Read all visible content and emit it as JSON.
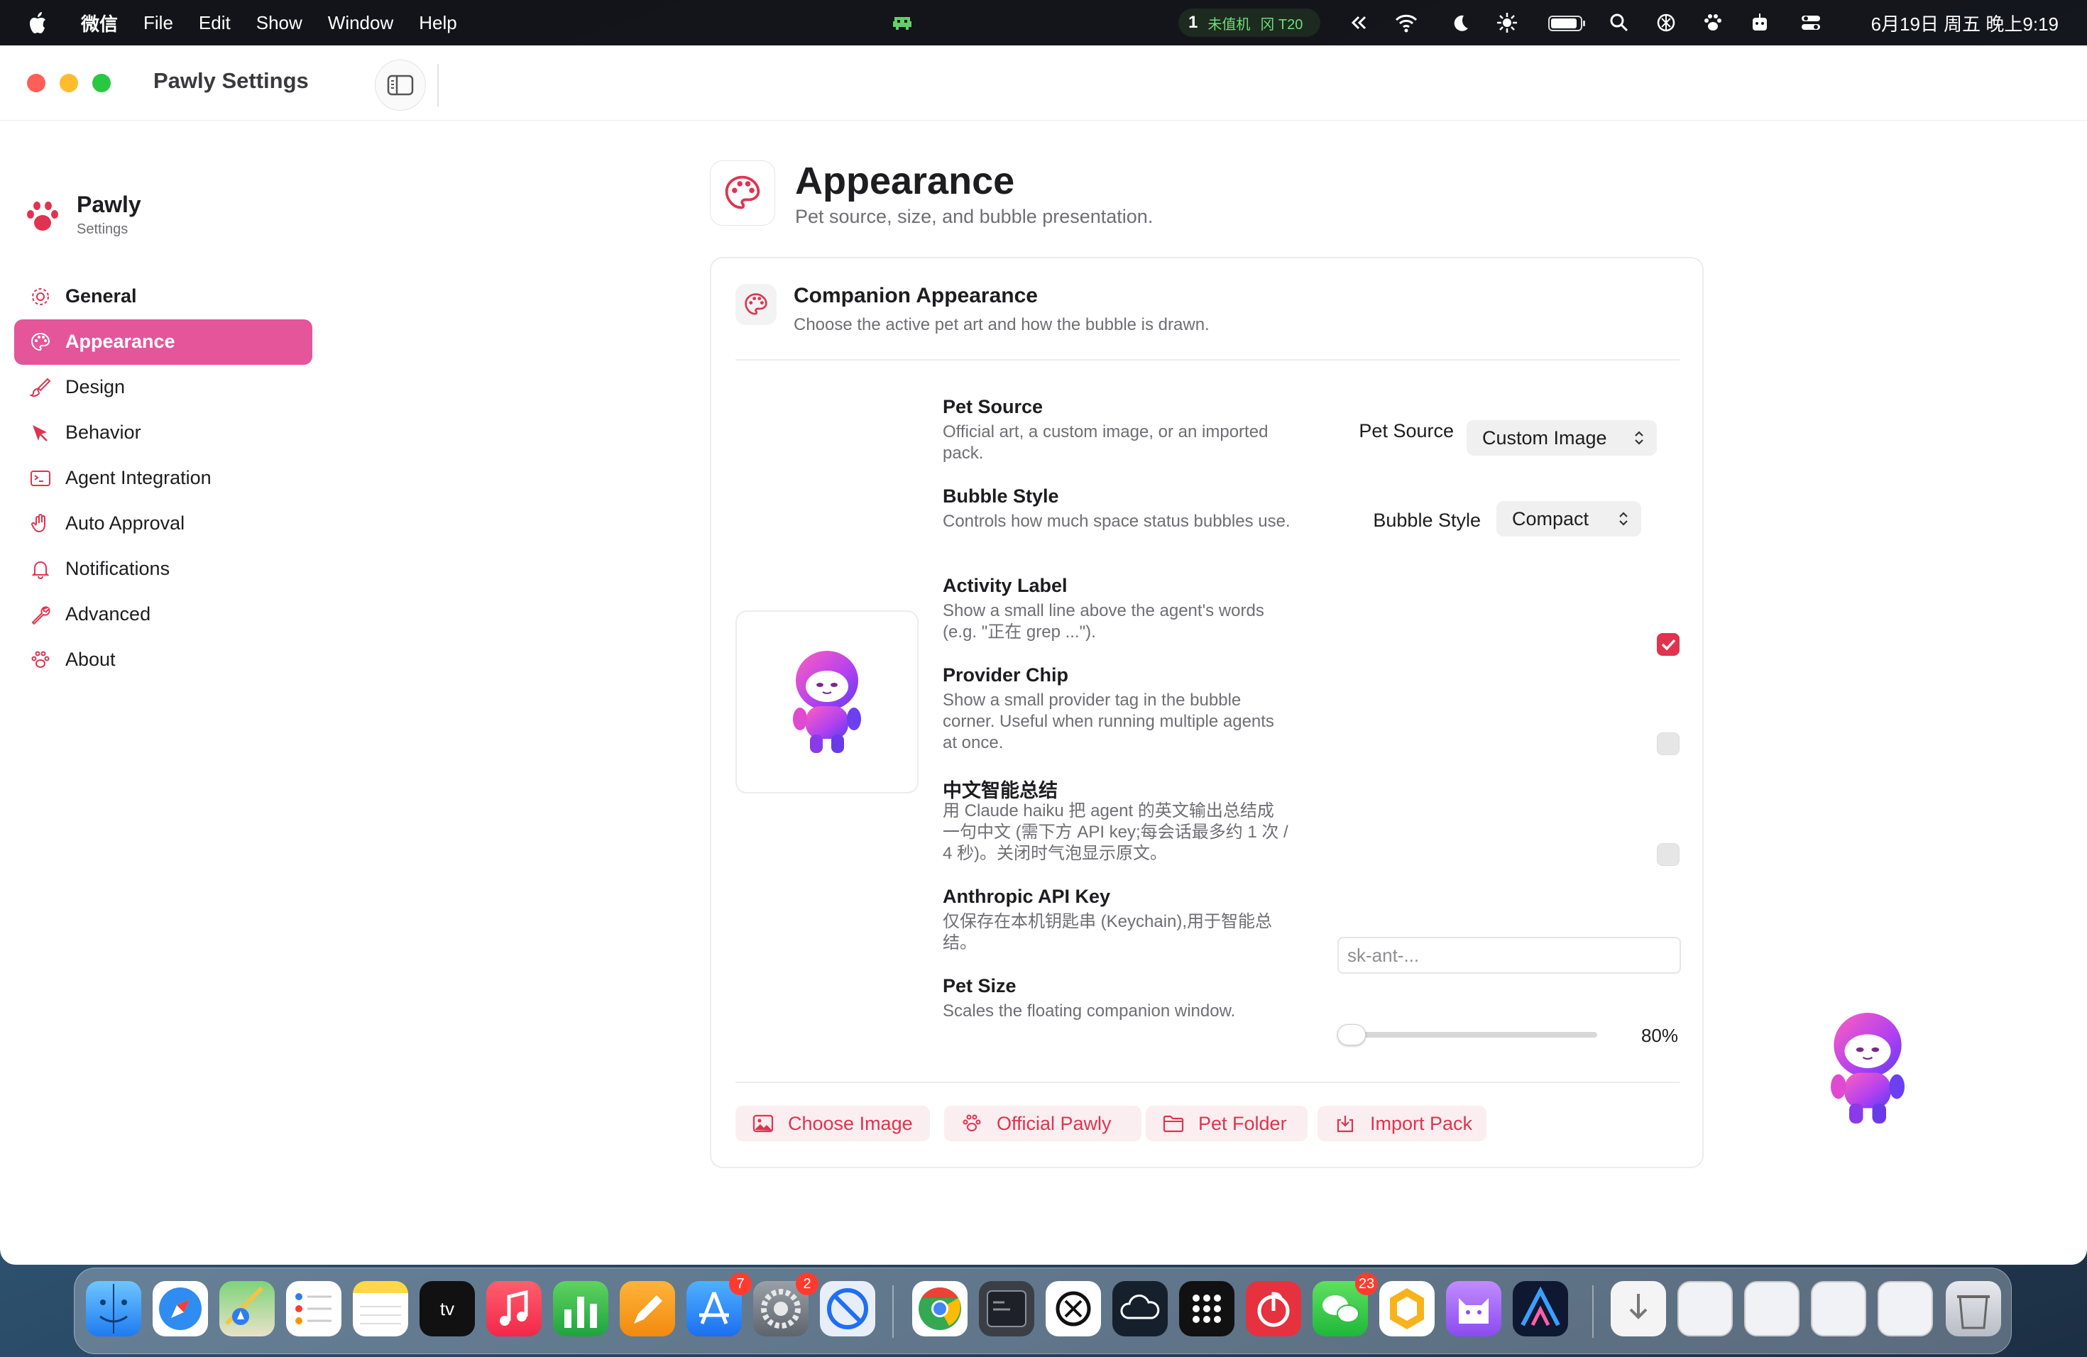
{
  "menubar": {
    "app_name": "微信",
    "items": [
      "File",
      "Edit",
      "Show",
      "Window",
      "Help"
    ],
    "status_number": "1",
    "status_text_1": "未值机",
    "status_text_2": "冈 T20",
    "clock": "6月19日 周五 晚上9:19"
  },
  "window": {
    "title": "Pawly Settings"
  },
  "sidebar": {
    "brand_name": "Pawly",
    "brand_sub": "Settings",
    "items": [
      {
        "label": "General",
        "icon": "gear-icon"
      },
      {
        "label": "Appearance",
        "icon": "palette-icon"
      },
      {
        "label": "Design",
        "icon": "paintbrush-icon"
      },
      {
        "label": "Behavior",
        "icon": "cursor-icon"
      },
      {
        "label": "Agent Integration",
        "icon": "terminal-icon"
      },
      {
        "label": "Auto Approval",
        "icon": "hand-icon"
      },
      {
        "label": "Notifications",
        "icon": "bell-icon"
      },
      {
        "label": "Advanced",
        "icon": "wrench-icon"
      },
      {
        "label": "About",
        "icon": "paw-icon"
      }
    ],
    "active_index": 1
  },
  "header": {
    "title": "Appearance",
    "subtitle": "Pet source, size, and bubble presentation."
  },
  "card": {
    "title": "Companion Appearance",
    "subtitle": "Choose the active pet art and how the bubble is drawn.",
    "rows": {
      "pet_source": {
        "title": "Pet Source",
        "desc": "Official art, a custom image, or an imported pack.",
        "control_label": "Pet Source",
        "value": "Custom Image"
      },
      "bubble_style": {
        "title": "Bubble Style",
        "desc": "Controls how much space status bubbles use.",
        "control_label": "Bubble Style",
        "value": "Compact"
      },
      "activity_label": {
        "title": "Activity Label",
        "desc": "Show a small line above the agent's words (e.g. \"正在 grep ...\").",
        "checked": true
      },
      "provider_chip": {
        "title": "Provider Chip",
        "desc": "Show a small provider tag in the bubble corner. Useful when running multiple agents at once.",
        "checked": false
      },
      "cn_summary": {
        "title": "中文智能总结",
        "desc": "用 Claude haiku 把 agent 的英文输出总结成一句中文 (需下方 API key;每会话最多约 1 次 / 4 秒)。关闭时气泡显示原文。",
        "checked": false
      },
      "api_key": {
        "title": "Anthropic API Key",
        "desc": "仅保存在本机钥匙串 (Keychain),用于智能总结。",
        "placeholder": "sk-ant-..."
      },
      "pet_size": {
        "title": "Pet Size",
        "desc": "Scales the floating companion window.",
        "value_label": "80%",
        "fraction": 0.0
      }
    },
    "buttons": [
      {
        "label": "Choose Image",
        "icon": "image-icon"
      },
      {
        "label": "Official Pawly",
        "icon": "paw-icon"
      },
      {
        "label": "Pet Folder",
        "icon": "folder-icon"
      },
      {
        "label": "Import Pack",
        "icon": "import-icon"
      }
    ]
  },
  "dock": {
    "badges": {
      "app_store": "7",
      "system_settings": "2",
      "wechat": "23"
    }
  },
  "colors": {
    "accent": "#e5559a",
    "accent_red": "#e0334f",
    "button_bg": "#fbeef0"
  }
}
